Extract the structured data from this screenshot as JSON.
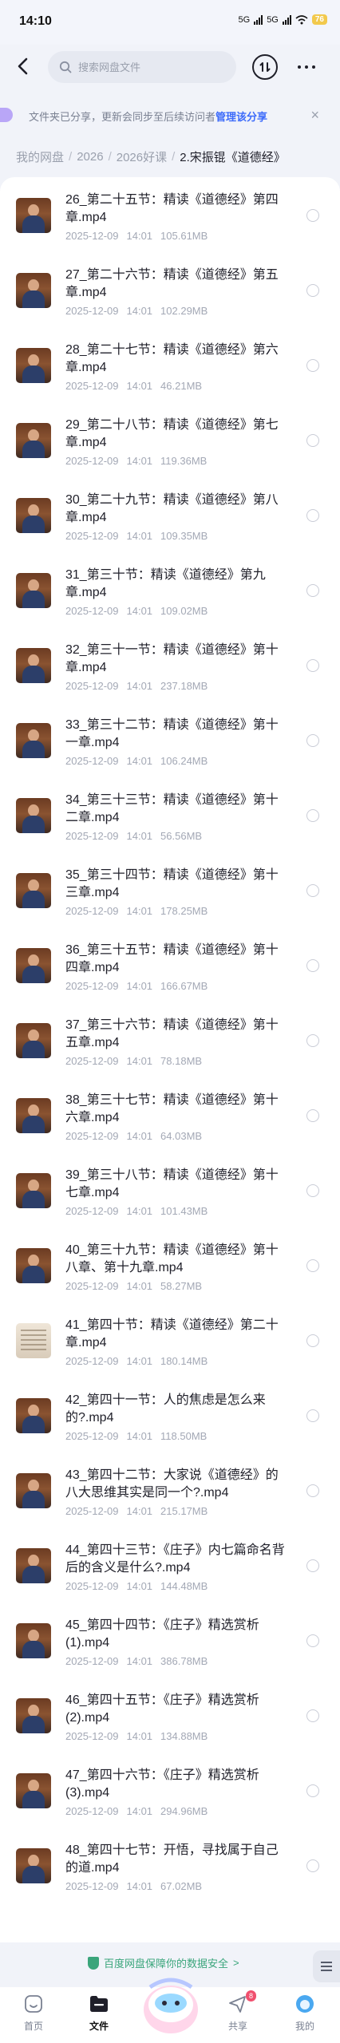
{
  "status_bar": {
    "time": "14:10",
    "net1": "5G",
    "net2": "5G",
    "battery": "76"
  },
  "header": {
    "search_placeholder": "搜索网盘文件"
  },
  "notice": {
    "text": "文件夹已分享，更新会同步至后续访问者",
    "link": "管理该分享"
  },
  "breadcrumb": [
    "我的网盘",
    "2026",
    "2026好课",
    "2.宋振锟《道德经》"
  ],
  "files": [
    {
      "name": "26_第二十五节：精读《道德经》第四章.mp4",
      "date": "2025-12-09",
      "time": "14:01",
      "size": "105.61MB",
      "thumb": "video"
    },
    {
      "name": "27_第二十六节：精读《道德经》第五章.mp4",
      "date": "2025-12-09",
      "time": "14:01",
      "size": "102.29MB",
      "thumb": "video"
    },
    {
      "name": "28_第二十七节：精读《道德经》第六章.mp4",
      "date": "2025-12-09",
      "time": "14:01",
      "size": "46.21MB",
      "thumb": "video"
    },
    {
      "name": "29_第二十八节：精读《道德经》第七章.mp4",
      "date": "2025-12-09",
      "time": "14:01",
      "size": "119.36MB",
      "thumb": "video"
    },
    {
      "name": "30_第二十九节：精读《道德经》第八章.mp4",
      "date": "2025-12-09",
      "time": "14:01",
      "size": "109.35MB",
      "thumb": "video"
    },
    {
      "name": "31_第三十节：精读《道德经》第九章.mp4",
      "date": "2025-12-09",
      "time": "14:01",
      "size": "109.02MB",
      "thumb": "video"
    },
    {
      "name": "32_第三十一节：精读《道德经》第十章.mp4",
      "date": "2025-12-09",
      "time": "14:01",
      "size": "237.18MB",
      "thumb": "video"
    },
    {
      "name": "33_第三十二节：精读《道德经》第十一章.mp4",
      "date": "2025-12-09",
      "time": "14:01",
      "size": "106.24MB",
      "thumb": "video"
    },
    {
      "name": "34_第三十三节：精读《道德经》第十二章.mp4",
      "date": "2025-12-09",
      "time": "14:01",
      "size": "56.56MB",
      "thumb": "video"
    },
    {
      "name": "35_第三十四节：精读《道德经》第十三章.mp4",
      "date": "2025-12-09",
      "time": "14:01",
      "size": "178.25MB",
      "thumb": "video"
    },
    {
      "name": "36_第三十五节：精读《道德经》第十四章.mp4",
      "date": "2025-12-09",
      "time": "14:01",
      "size": "166.67MB",
      "thumb": "video"
    },
    {
      "name": "37_第三十六节：精读《道德经》第十五章.mp4",
      "date": "2025-12-09",
      "time": "14:01",
      "size": "78.18MB",
      "thumb": "video"
    },
    {
      "name": "38_第三十七节：精读《道德经》第十六章.mp4",
      "date": "2025-12-09",
      "time": "14:01",
      "size": "64.03MB",
      "thumb": "video"
    },
    {
      "name": "39_第三十八节：精读《道德经》第十七章.mp4",
      "date": "2025-12-09",
      "time": "14:01",
      "size": "101.43MB",
      "thumb": "video"
    },
    {
      "name": "40_第三十九节：精读《道德经》第十八章、第十九章.mp4",
      "date": "2025-12-09",
      "time": "14:01",
      "size": "58.27MB",
      "thumb": "video"
    },
    {
      "name": "41_第四十节：精读《道德经》第二十章.mp4",
      "date": "2025-12-09",
      "time": "14:01",
      "size": "180.14MB",
      "thumb": "doc"
    },
    {
      "name": "42_第四十一节：人的焦虑是怎么来的?.mp4",
      "date": "2025-12-09",
      "time": "14:01",
      "size": "118.50MB",
      "thumb": "video"
    },
    {
      "name": "43_第四十二节：大家说《道德经》的八大思维其实是同一个?.mp4",
      "date": "2025-12-09",
      "time": "14:01",
      "size": "215.17MB",
      "thumb": "video"
    },
    {
      "name": "44_第四十三节：《庄子》内七篇命名背后的含义是什么?.mp4",
      "date": "2025-12-09",
      "time": "14:01",
      "size": "144.48MB",
      "thumb": "video"
    },
    {
      "name": "45_第四十四节：《庄子》精选赏析(1).mp4",
      "date": "2025-12-09",
      "time": "14:01",
      "size": "386.78MB",
      "thumb": "video"
    },
    {
      "name": "46_第四十五节：《庄子》精选赏析(2).mp4",
      "date": "2025-12-09",
      "time": "14:01",
      "size": "134.88MB",
      "thumb": "video"
    },
    {
      "name": "47_第四十六节：《庄子》精选赏析(3).mp4",
      "date": "2025-12-09",
      "time": "14:01",
      "size": "294.96MB",
      "thumb": "video"
    },
    {
      "name": "48_第四十七节：开悟，寻找属于自己的道.mp4",
      "date": "2025-12-09",
      "time": "14:01",
      "size": "67.02MB",
      "thumb": "video"
    }
  ],
  "security": {
    "text": "百度网盘保障你的数据安全",
    "arrow": ">"
  },
  "tabbar": {
    "tabs": [
      {
        "label": "首页",
        "icon": "home-icon"
      },
      {
        "label": "文件",
        "icon": "folder-icon"
      },
      {
        "label": "共享",
        "icon": "share-icon",
        "badge": "8"
      },
      {
        "label": "我的",
        "icon": "profile-icon"
      }
    ]
  },
  "colors": {
    "accent": "#3d6bfa",
    "security": "#3aa57b",
    "badge": "#f0506e"
  }
}
